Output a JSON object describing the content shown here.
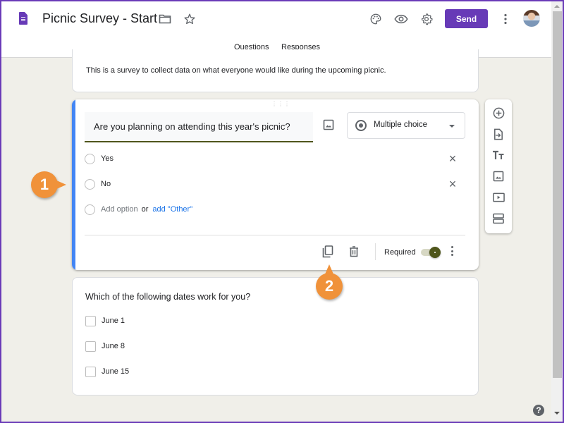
{
  "header": {
    "app_icon": "google-forms-icon",
    "title": "Picnic Survey - Start",
    "icons": [
      "folder-icon",
      "star-icon",
      "palette-icon",
      "eye-icon",
      "gear-icon",
      "more-vert-icon"
    ],
    "send_label": "Send",
    "avatar": "user-avatar"
  },
  "tabs": [
    {
      "label": "Questions",
      "active": true
    },
    {
      "label": "Responses",
      "active": false
    }
  ],
  "description": "This is a survey to collect data on what everyone would like during the upcoming picnic.",
  "question1": {
    "title": "Are you planning on attending this year's picnic?",
    "type": "Multiple choice",
    "options": [
      "Yes",
      "No"
    ],
    "add_option": "Add option",
    "or": "or",
    "add_other": "add \"Other\"",
    "required_label": "Required",
    "required": true
  },
  "question2": {
    "title": "Which of the following dates work for you?",
    "options": [
      "June 1",
      "June 8",
      "June 15"
    ]
  },
  "side_toolbar": [
    "add-question-icon",
    "import-questions-icon",
    "add-title-icon",
    "add-image-icon",
    "add-video-icon",
    "add-section-icon"
  ],
  "callouts": [
    "1",
    "2"
  ],
  "help": "?",
  "colors": {
    "brand": "#673ab7",
    "accent": "#4f561c",
    "active_card": "#4285f4",
    "link": "#1a73e8",
    "callout": "#f0923a",
    "background": "#f0efe9"
  }
}
